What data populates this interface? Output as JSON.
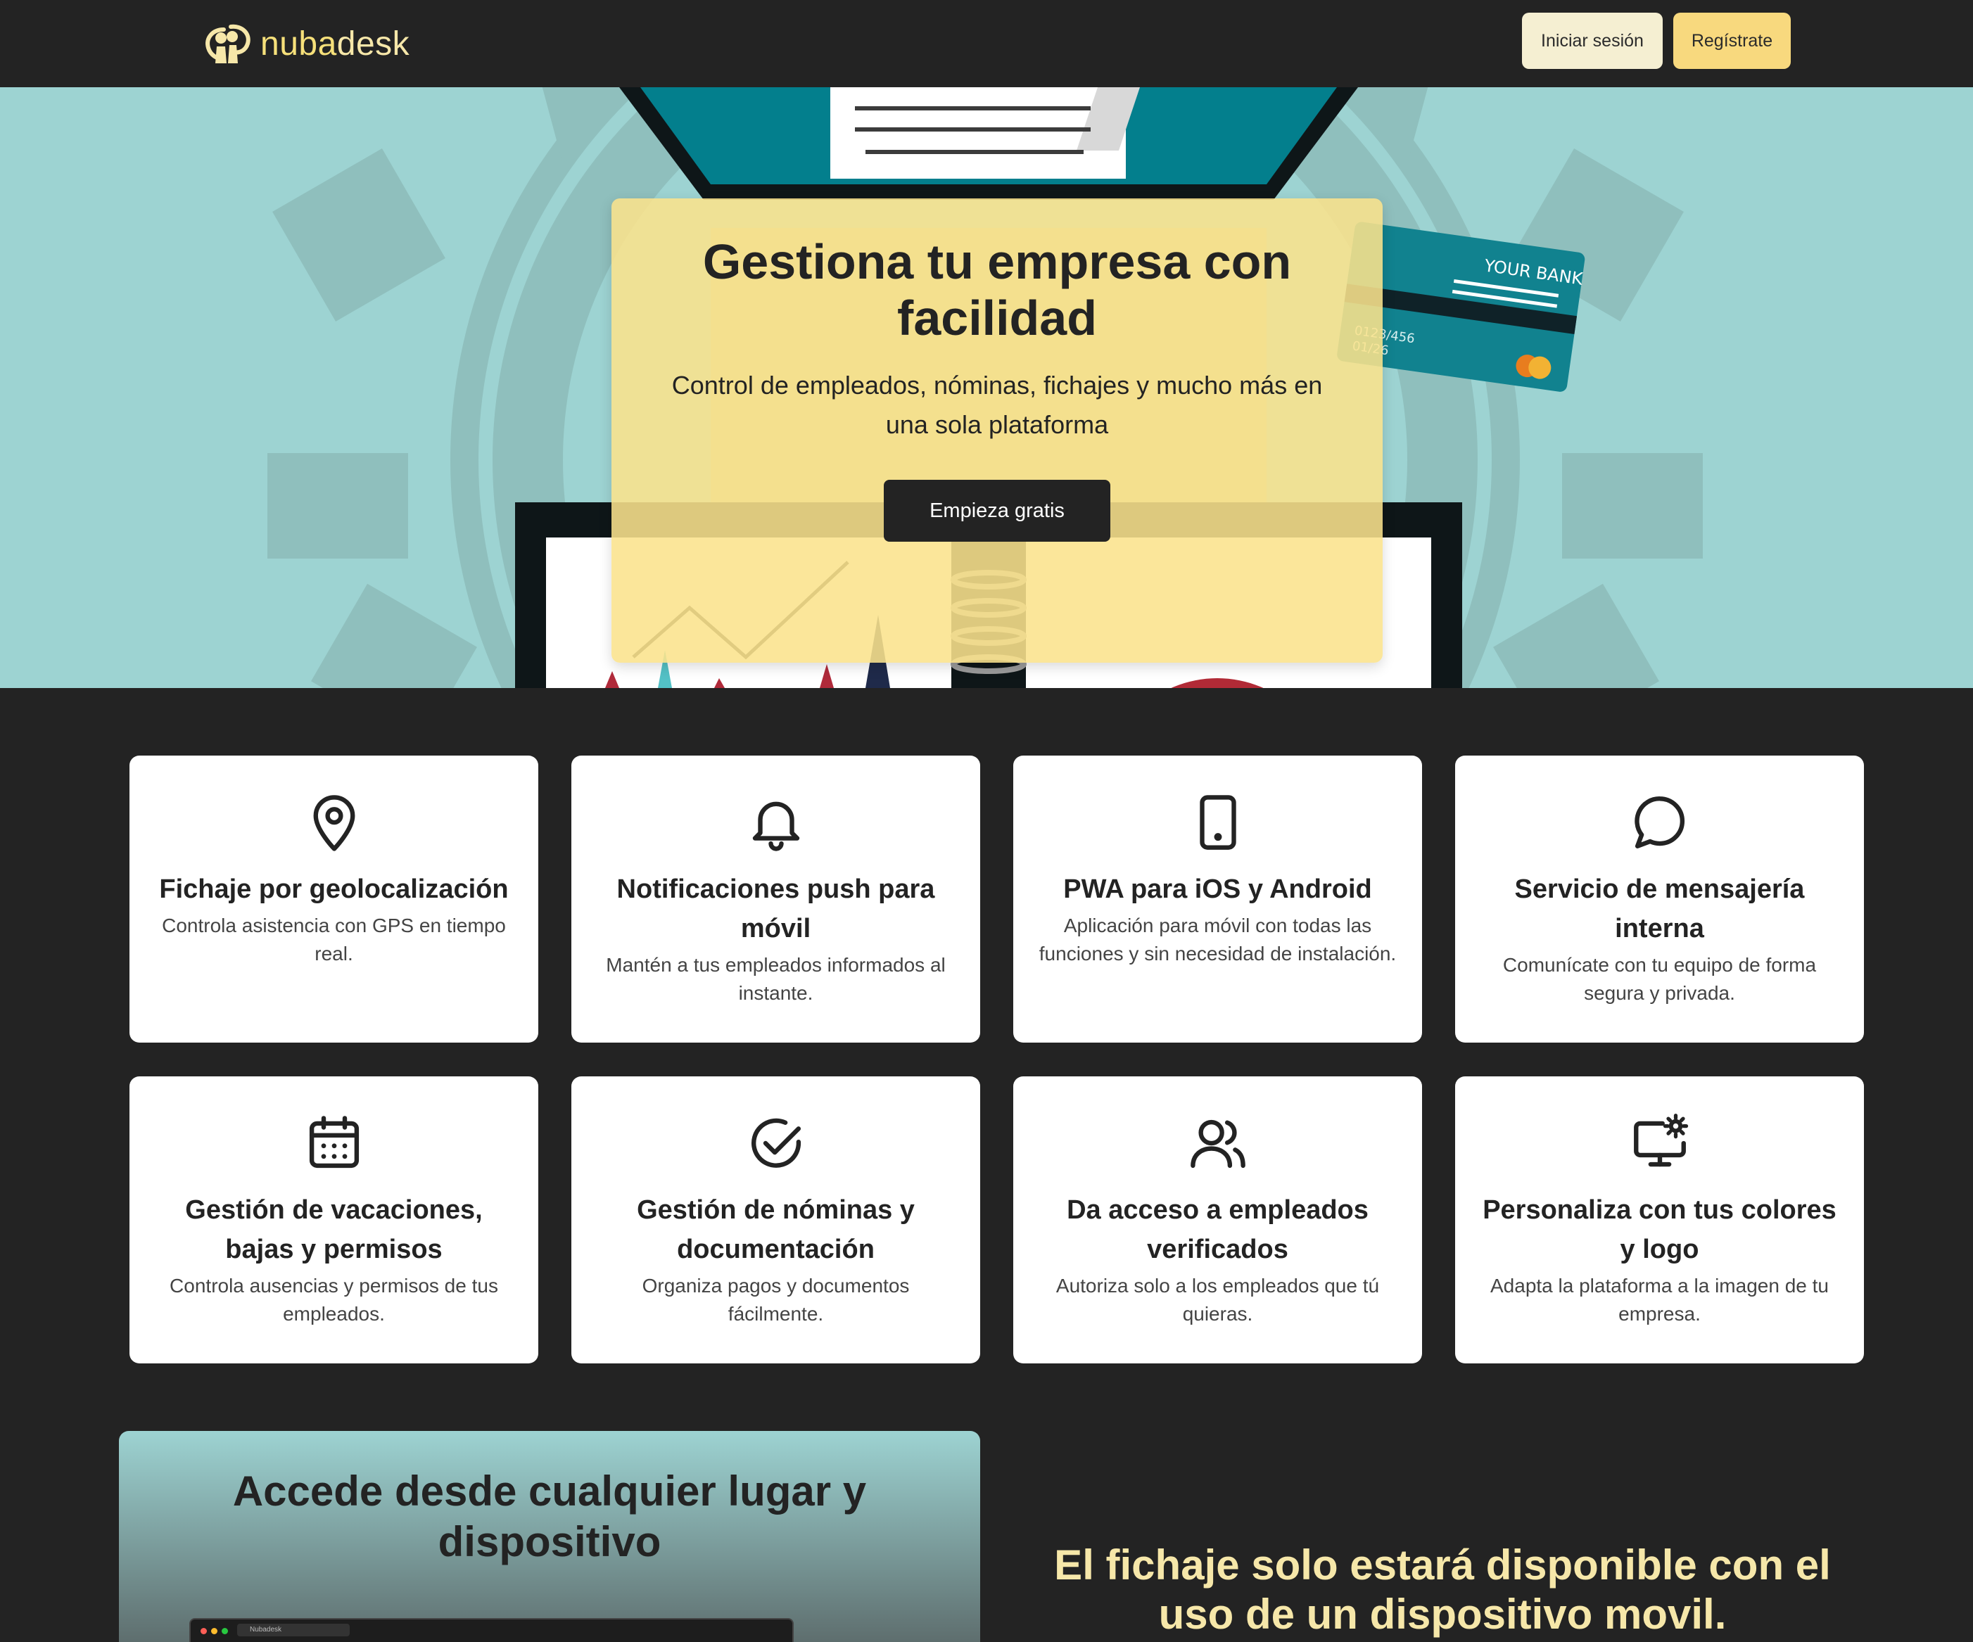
{
  "nav": {
    "brand_part1": "nuba",
    "brand_part2": "desk",
    "logo_icon": "nubadesk-logo",
    "login_label": "Iniciar sesión",
    "register_label": "Regístrate"
  },
  "hero": {
    "title": "Gestiona tu empresa con facilidad",
    "subtitle": "Control de empleados, nóminas, fichajes y mucho más en una sola plataforma",
    "cta_label": "Empieza gratis",
    "card_text": "YOUR BANK",
    "card_number": "0123/456",
    "card_date": "01/26"
  },
  "features": [
    {
      "icon": "map-pin-icon",
      "title": "Fichaje por geolocalización",
      "desc": "Controla asistencia con GPS en tiempo real."
    },
    {
      "icon": "bell-icon",
      "title": "Notificaciones push para móvil",
      "desc": "Mantén a tus empleados informados al instante."
    },
    {
      "icon": "tablet-icon",
      "title": "PWA para iOS y Android",
      "desc": "Aplicación para móvil con todas las funciones y sin necesidad de instalación."
    },
    {
      "icon": "chat-bubble-icon",
      "title": "Servicio de mensajería interna",
      "desc": "Comunícate con tu equipo de forma segura y privada."
    },
    {
      "icon": "calendar-icon",
      "title": "Gestión de vacaciones, bajas y permisos",
      "desc": "Controla ausencias y permisos de tus empleados."
    },
    {
      "icon": "check-circle-icon",
      "title": "Gestión de nóminas y documentación",
      "desc": "Organiza pagos y documentos fácilmente."
    },
    {
      "icon": "users-icon",
      "title": "Da acceso a empleados verificados",
      "desc": "Autoriza solo a los empleados que tú quieras."
    },
    {
      "icon": "monitor-gear-icon",
      "title": "Personaliza con tus colores y logo",
      "desc": "Adapta la plataforma a la imagen de tu empresa."
    }
  ],
  "access": {
    "title": "Accede desde cualquier lugar y dispositivo",
    "mini_tab_label": "Nubadesk"
  },
  "device_note": "El fichaje solo estará disponible con el uso de un dispositivo movil.",
  "colors": {
    "bg_dark": "#232323",
    "hero_teal": "#9dd3d2",
    "accent_yellow": "#f8d97e",
    "login_cream": "#f5efd2",
    "brand_text": "#f6e7a9"
  }
}
